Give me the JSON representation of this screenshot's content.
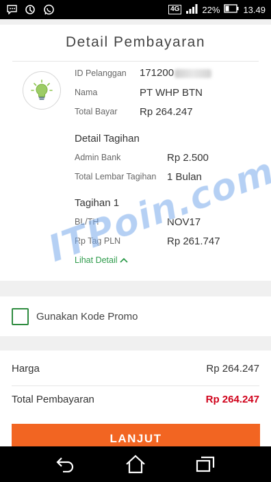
{
  "status_bar": {
    "network": "4G",
    "battery": "22%",
    "time": "13.49",
    "icons": [
      "bbm-icon",
      "sync-icon",
      "whatsapp-icon",
      "signal-icon",
      "battery-icon"
    ]
  },
  "header": {
    "title": "Detail Pembayaran"
  },
  "customer": {
    "biller_icon": "lightbulb-icon",
    "id_label": "ID Pelanggan",
    "id_value": "171200",
    "name_label": "Nama",
    "name_value": "PT WHP BTN",
    "total_label": "Total Bayar",
    "total_value": "Rp 264.247"
  },
  "bill_detail": {
    "title": "Detail Tagihan",
    "admin_label": "Admin Bank",
    "admin_value": "Rp 2.500",
    "sheets_label": "Total Lembar Tagihan",
    "sheets_value": "1 Bulan"
  },
  "bill_1": {
    "title": "Tagihan 1",
    "period_label": "BL/TH",
    "period_value": "NOV17",
    "pln_label": "Rp Tag PLN",
    "pln_value": "Rp 261.747",
    "see_detail": "Lihat Detail"
  },
  "watermark": "ITPoin.com",
  "promo": {
    "label": "Gunakan Kode Promo",
    "checked": false
  },
  "summary": {
    "price_label": "Harga",
    "price_value": "Rp 264.247",
    "total_label": "Total Pembayaran",
    "total_value": "Rp 264.247"
  },
  "cta": {
    "label": "LANJUT"
  },
  "colors": {
    "accent": "#f26522",
    "total": "#d0021b",
    "green": "#2e9b4b"
  },
  "nav_icons": [
    "back-icon",
    "home-icon",
    "recent-apps-icon"
  ]
}
